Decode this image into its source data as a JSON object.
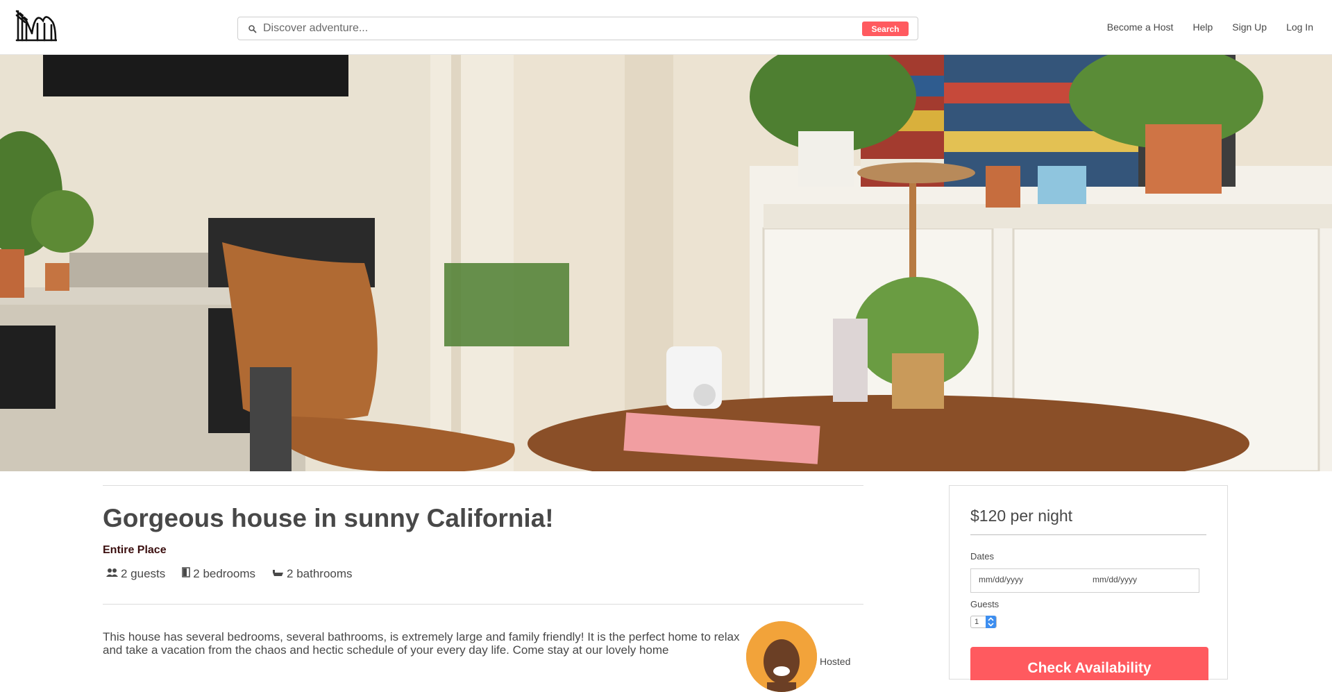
{
  "header": {
    "logo_icon": "roller-coaster-logo",
    "search": {
      "placeholder": "Discover adventure...",
      "value": "",
      "button_label": "Search"
    },
    "nav": [
      {
        "label": "Become a Host"
      },
      {
        "label": "Help"
      },
      {
        "label": "Sign Up"
      },
      {
        "label": "Log In"
      }
    ]
  },
  "hero": {
    "image": "living-room-photo"
  },
  "listing": {
    "title": "Gorgeous house in sunny California!",
    "place_type": "Entire Place",
    "amenities": [
      {
        "icon": "users-icon",
        "label": "2 guests"
      },
      {
        "icon": "door-icon",
        "label": "2 bedrooms"
      },
      {
        "icon": "bathtub-icon",
        "label": "2 bathrooms"
      }
    ],
    "description": "This house has several bedrooms, several bathrooms, is extremely large and family friendly! It is the perfect home to relax and take a vacation from the chaos and hectic schedule of your every day life. Come stay at our lovely home",
    "host_label": "Hosted"
  },
  "booking": {
    "price": "$120 per night",
    "dates_label": "Dates",
    "checkin_placeholder": "mm/dd/yyyy",
    "checkout_placeholder": "mm/dd/yyyy",
    "guests_label": "Guests",
    "guests_value": "1",
    "check_button_label": "Check Availability"
  },
  "colors": {
    "accent": "#ff5a5f",
    "text": "#484848",
    "place_type": "#3b0f0f"
  }
}
